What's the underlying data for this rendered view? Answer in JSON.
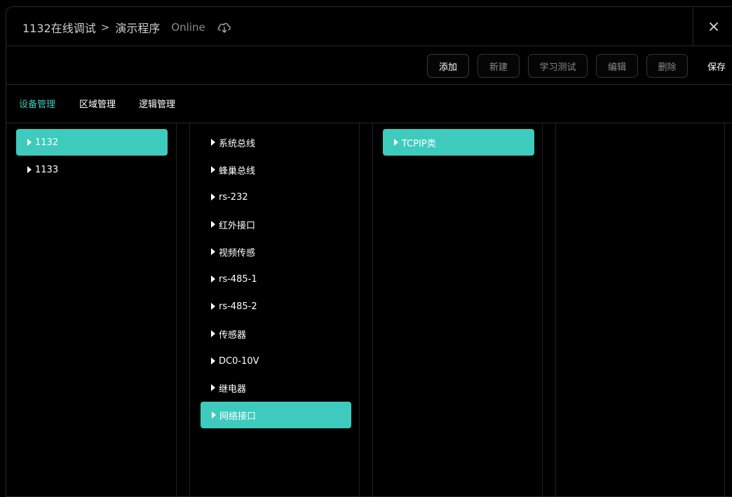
{
  "header": {
    "project": "1132在线调试",
    "separator": ">",
    "program": "演示程序",
    "status": "Online"
  },
  "toolbar": {
    "add": "添加",
    "new": "新建",
    "learn_test": "学习测试",
    "edit": "编辑",
    "delete": "删除",
    "save": "保存"
  },
  "tabs": [
    "设备管理",
    "区域管理",
    "逻辑管理"
  ],
  "columns": {
    "devices": [
      "1132",
      "1133"
    ],
    "interfaces": [
      "系统总线",
      "蜂巢总线",
      "rs-232",
      "红外接口",
      "视频传感",
      "rs-485-1",
      "rs-485-2",
      "传感器",
      "DC0-10V",
      "继电器",
      "网络接口"
    ],
    "types": [
      "TCPIP类"
    ]
  },
  "colors": {
    "accent": "#3ecbbd",
    "background": "#000000",
    "muted_text": "#8a8a8a"
  }
}
